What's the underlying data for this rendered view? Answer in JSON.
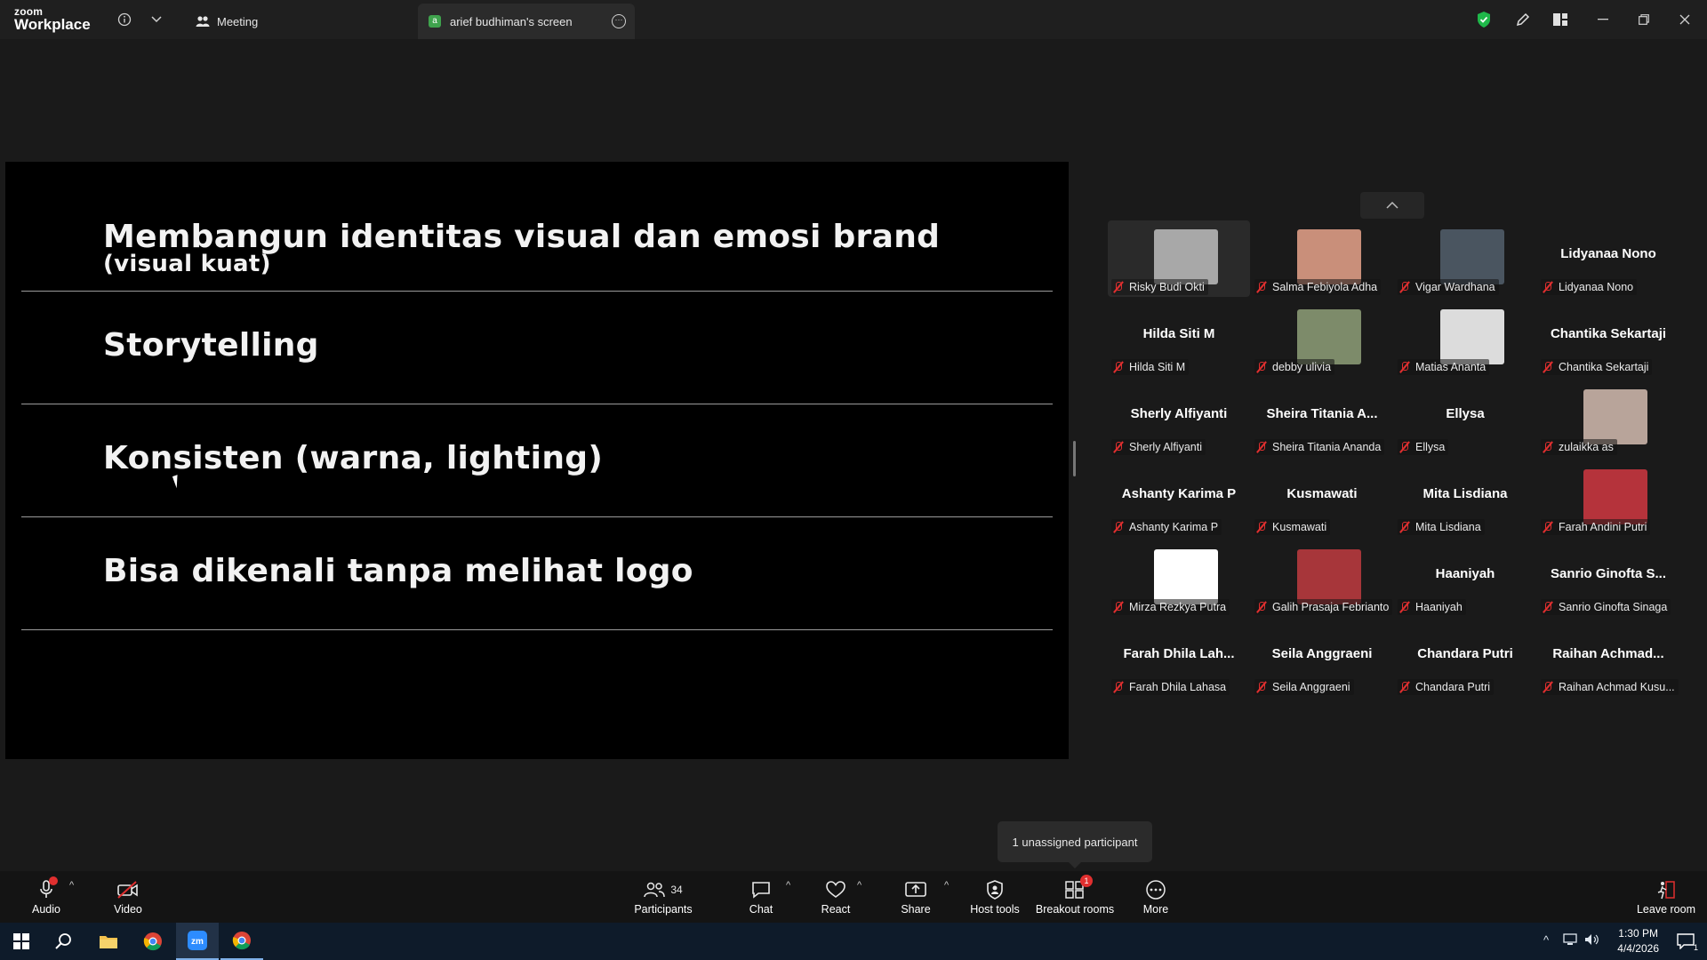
{
  "titlebar": {
    "logo_line1": "zoom",
    "logo_line2": "Workplace",
    "tabs": [
      {
        "label": "Meeting"
      },
      {
        "label": "arief budhiman's screen",
        "avatar_letter": "a"
      }
    ]
  },
  "slide": {
    "rows": [
      {
        "text": "Membangun identitas visual dan emosi brand",
        "subtext": "(visual kuat)"
      },
      {
        "text": "Storytelling"
      },
      {
        "text": "Konsisten (warna, lighting)"
      },
      {
        "text": "Bisa dikenali tanpa melihat logo"
      }
    ]
  },
  "gallery": {
    "participants": [
      {
        "display": "",
        "label": "Risky Budi Okti",
        "video": true,
        "color": "#a8a8a8"
      },
      {
        "display": "",
        "label": "Salma Febiyola Adha",
        "video": true,
        "color": "#c98f7a"
      },
      {
        "display": "",
        "label": "Vigar Wardhana",
        "video": true,
        "color": "#4a5560"
      },
      {
        "display": "Lidyanaa Nono",
        "label": "Lidyanaa Nono",
        "video": false
      },
      {
        "display": "Hilda Siti M",
        "label": "Hilda Siti M",
        "video": false
      },
      {
        "display": "",
        "label": "debby ulivia",
        "video": true,
        "color": "#7d8b6a"
      },
      {
        "display": "",
        "label": "Matias Ananta",
        "video": true,
        "color": "#dcdcdc"
      },
      {
        "display": "Chantika Sekartaji",
        "label": "Chantika Sekartaji",
        "video": false
      },
      {
        "display": "Sherly Alfiyanti",
        "label": "Sherly Alfiyanti",
        "video": false
      },
      {
        "display": "Sheira Titania A...",
        "label": "Sheira Titania Ananda",
        "video": false
      },
      {
        "display": "Ellysa",
        "label": "Ellysa",
        "video": false
      },
      {
        "display": "",
        "label": "zulaikka as",
        "video": true,
        "color": "#b8a49a"
      },
      {
        "display": "Ashanty Karima P",
        "label": "Ashanty Karima P",
        "video": false
      },
      {
        "display": "Kusmawati",
        "label": "Kusmawati",
        "video": false
      },
      {
        "display": "Mita Lisdiana",
        "label": "Mita Lisdiana",
        "video": false
      },
      {
        "display": "",
        "label": "Farah Andini Putri",
        "video": true,
        "color": "#b5333b"
      },
      {
        "display": "",
        "label": "Mirza Rezkya Putra",
        "video": true,
        "color": "#ffffff"
      },
      {
        "display": "",
        "label": "Galih Prasaja Febrianto",
        "video": true,
        "color": "#a7363a"
      },
      {
        "display": "Haaniyah",
        "label": "Haaniyah",
        "video": false
      },
      {
        "display": "Sanrio Ginofta S...",
        "label": "Sanrio Ginofta Sinaga",
        "video": false
      },
      {
        "display": "Farah Dhila Lah...",
        "label": "Farah Dhila Lahasa",
        "video": false
      },
      {
        "display": "Seila Anggraeni",
        "label": "Seila Anggraeni",
        "video": false
      },
      {
        "display": "Chandara Putri",
        "label": "Chandara Putri",
        "video": false
      },
      {
        "display": "Raihan Achmad...",
        "label": "Raihan Achmad Kusu...",
        "video": false
      }
    ]
  },
  "tooltip": {
    "text": "1 unassigned participant"
  },
  "controls": {
    "audio": "Audio",
    "video": "Video",
    "participants": "Participants",
    "participants_count": "34",
    "chat": "Chat",
    "react": "React",
    "share": "Share",
    "host_tools": "Host tools",
    "breakout_rooms": "Breakout rooms",
    "breakout_badge": "1",
    "more": "More",
    "leave_room": "Leave room"
  },
  "taskbar": {
    "time": "1:30 PM",
    "date": "4/4/2026",
    "notification_count": "1"
  },
  "colors": {
    "accent_green": "#3fa34d",
    "mute_red": "#e02f2f",
    "shield_green": "#1fb84a"
  }
}
